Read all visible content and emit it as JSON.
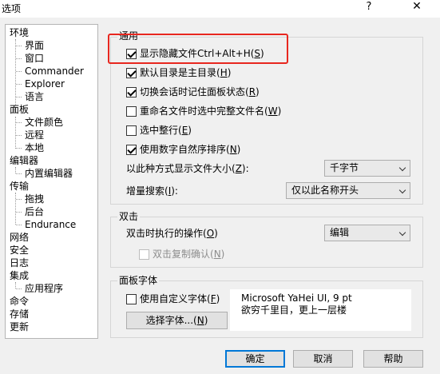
{
  "window": {
    "title": "选项",
    "help_glyph": "?",
    "close_glyph": "✕"
  },
  "tree": {
    "items": [
      {
        "label": "环境",
        "level": 1
      },
      {
        "label": "界面",
        "level": 2
      },
      {
        "label": "窗口",
        "level": 2
      },
      {
        "label": "Commander",
        "level": 2
      },
      {
        "label": "Explorer",
        "level": 2
      },
      {
        "label": "语言",
        "level": 2
      },
      {
        "label": "面板",
        "level": 1
      },
      {
        "label": "文件颜色",
        "level": 2
      },
      {
        "label": "远程",
        "level": 2
      },
      {
        "label": "本地",
        "level": 2
      },
      {
        "label": "编辑器",
        "level": 1
      },
      {
        "label": "内置编辑器",
        "level": 2
      },
      {
        "label": "传输",
        "level": 1
      },
      {
        "label": "拖拽",
        "level": 2
      },
      {
        "label": "后台",
        "level": 2
      },
      {
        "label": "Endurance",
        "level": 2
      },
      {
        "label": "网络",
        "level": 1
      },
      {
        "label": "安全",
        "level": 1
      },
      {
        "label": "日志",
        "level": 1
      },
      {
        "label": "集成",
        "level": 1
      },
      {
        "label": "应用程序",
        "level": 2
      },
      {
        "label": "命令",
        "level": 1
      },
      {
        "label": "存储",
        "level": 1
      },
      {
        "label": "更新",
        "level": 1
      }
    ]
  },
  "general": {
    "title": "通用",
    "show_hidden": {
      "label": "显示隐藏文件Ctrl+Alt+H(",
      "key": "S",
      "close": ")",
      "checked": true
    },
    "default_main": {
      "label": "默认目录是主目录(",
      "key": "H",
      "close": ")",
      "checked": true
    },
    "remember_panel": {
      "label": "切换会话时记住面板状态(",
      "key": "R",
      "close": ")",
      "checked": true
    },
    "select_full_name": {
      "label": "重命名文件时选中完整文件名(",
      "key": "W",
      "close": ")",
      "checked": false
    },
    "select_whole_row": {
      "label": "选中整行(",
      "key": "E",
      "close": ")",
      "checked": false
    },
    "natural_sort": {
      "label": "使用数字自然序排序(",
      "key": "N",
      "close": ")",
      "checked": true
    },
    "size_format_label": "以此种方式显示文件大小(",
    "size_format_key": "Z",
    "size_format_close": "):",
    "size_format_value": "千字节",
    "incremental_label": "增量搜索(",
    "incremental_key": "I",
    "incremental_close": "):",
    "incremental_value": "仅以此名称开头"
  },
  "doubleclick": {
    "title": "双击",
    "action_label": "双击时执行的操作(",
    "action_key": "O",
    "action_close": ")",
    "action_value": "编辑",
    "confirm_copy": {
      "label": "双击复制确认(",
      "key": "N",
      "close": ")",
      "checked": false,
      "disabled": true
    }
  },
  "panelfont": {
    "title": "面板字体",
    "custom_font": {
      "label": "使用自定义字体(",
      "key": "F",
      "close": ")",
      "checked": false
    },
    "select_font_label": "选择字体...(",
    "select_font_key": "N",
    "select_font_close": ")",
    "preview_line1": "Microsoft YaHei UI, 9 pt",
    "preview_line2": "欲穷千里目，更上一层楼"
  },
  "footer": {
    "ok": "确定",
    "cancel": "取消",
    "help": "帮助"
  },
  "highlight_color": "#e8271f",
  "accent_color": "#0078d7"
}
